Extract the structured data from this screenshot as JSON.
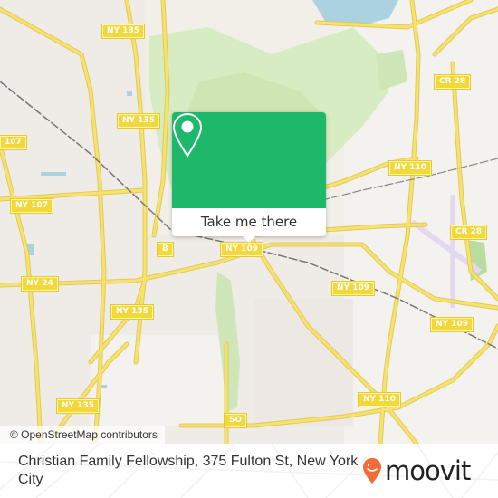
{
  "map": {
    "attribution": "© OpenStreetMap contributors",
    "road_labels": [
      {
        "id": "ny135-top",
        "text": "NY 135"
      },
      {
        "id": "ny135-mid",
        "text": "NY 135"
      },
      {
        "id": "ny107-left",
        "text": "107"
      },
      {
        "id": "ny107",
        "text": "NY 107"
      },
      {
        "id": "ny24",
        "text": "NY 24"
      },
      {
        "id": "ny135-lower",
        "text": "NY 135"
      },
      {
        "id": "ny135-bottom",
        "text": "NY 135"
      },
      {
        "id": "b",
        "text": "B"
      },
      {
        "id": "ny109-center",
        "text": "NY 109"
      },
      {
        "id": "ny109-east",
        "text": "NY 109"
      },
      {
        "id": "ny109-far-east",
        "text": "NY 109"
      },
      {
        "id": "ny110-north",
        "text": "NY 110"
      },
      {
        "id": "ny110-south",
        "text": "NY 110"
      },
      {
        "id": "cr28-north",
        "text": "CR 28"
      },
      {
        "id": "cr28-south",
        "text": "CR 28"
      },
      {
        "id": "so",
        "text": "SO"
      }
    ]
  },
  "popup": {
    "button_label": "Take me there",
    "icon": "map-pin-icon"
  },
  "footer": {
    "place_title": "Christian Family Fellowship, 375 Fulton St, New York City",
    "brand": "moovit"
  },
  "colors": {
    "popup_green": "#1db86a",
    "moovit_orange": "#f26b3a",
    "road_yellow": "#f7e36b",
    "water_blue": "#aad3df",
    "park_green": "#cde8b0"
  }
}
